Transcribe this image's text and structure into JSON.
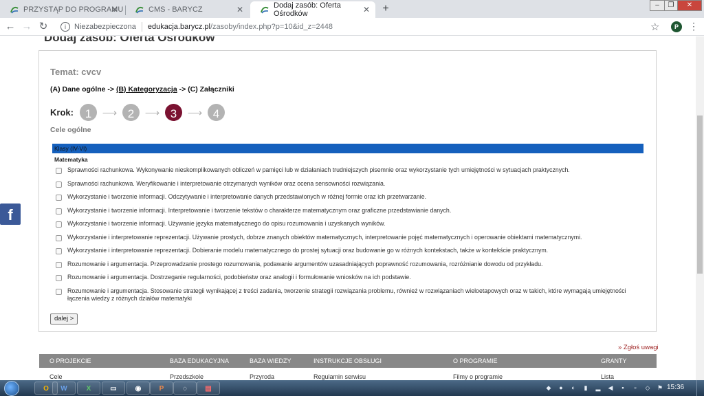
{
  "browser": {
    "tabs": [
      {
        "label": "PRZYSTĄP DO PROGRAMU",
        "active": false
      },
      {
        "label": "CMS - BARYCZ",
        "active": false
      },
      {
        "label": "Dodaj zasób: Oferta Ośrodków",
        "active": true
      }
    ],
    "new_tab_symbol": "+",
    "security_label": "Niezabezpieczona",
    "url_host": "edukacja.barycz.pl",
    "url_path": "/zasoby/index.php?p=10&id_z=2448",
    "profile_initial": "P"
  },
  "page": {
    "heading": "Dodaj zasób: Oferta Ośrodków",
    "topic": "Temat: cvcv",
    "path": {
      "part_a": "(A) Dane ogólne ->",
      "part_b": "(B) Kategoryzacja",
      "part_c": "-> (C) Załączniki"
    },
    "krok_label": "Krok:",
    "steps": [
      "1",
      "2",
      "3",
      "4"
    ],
    "current_step": 3,
    "goals_title": "Cele ogólne",
    "class_bar": "Klasy (IV-VI)",
    "subject": "Matematyka",
    "goals": [
      "Sprawności rachunkowa. Wykonywanie nieskomplikowanych obliczeń w pamięci lub w działaniach trudniejszych pisemnie oraz wykorzystanie tych umiejętności w sytuacjach praktycznych.",
      "Sprawności rachunkowa. Weryfikowanie i interpretowanie otrzymanych wyników oraz ocena sensowności rozwiązania.",
      "Wykorzystanie i tworzenie informacji. Odczytywanie i interpretowanie danych przedstawionych w różnej formie oraz ich przetwarzanie.",
      "Wykorzystanie i tworzenie informacji. Interpretowanie i tworzenie tekstów o charakterze matematycznym oraz graficzne przedstawianie danych.",
      "Wykorzystanie i tworzenie informacji. Używanie języka matematycznego do opisu rozumowania i uzyskanych wyników.",
      "Wykorzystanie i interpretowanie reprezentacji. Używanie prostych, dobrze znanych obiektów matematycznych, interpretowanie pojęć matematycznych i operowanie obiektami matematycznymi.",
      "Wykorzystanie i interpretowanie reprezentacji. Dobieranie modelu matematycznego do prostej sytuacji oraz budowanie go w różnych kontekstach, także w kontekście praktycznym.",
      "Rozumowanie i argumentacja. Przeprowadzanie prostego rozumowania, podawanie argumentów uzasadniających poprawność rozumowania, rozróżnianie dowodu od przykładu.",
      "Rozumowanie i argumentacja. Dostrzeganie regularności, podobieństw oraz analogii i formułowanie wniosków na ich podstawie.",
      "Rozumowanie i argumentacja. Stosowanie strategii wynikającej z treści zadania, tworzenie strategii rozwiązania problemu, również w rozwiązaniach wieloetapowych oraz w takich, które wymagają umiejętności łączenia wiedzy z różnych działów matematyki"
    ],
    "next_button": "dalej >",
    "report_link": "» Zgłoś uwagi",
    "facebook_letter": "f"
  },
  "footer": {
    "headers": [
      "O PROJEKCIE",
      "BAZA EDUKACYJNA",
      "BAZA WIEDZY",
      "INSTRUKCJE OBSŁUGI",
      "O PROGRAMIE",
      "GRANTY"
    ],
    "links": [
      "Cele",
      "Przedszkole",
      "Przyroda",
      "Regulamin serwisu",
      "Filmy o programie",
      "Lista"
    ]
  },
  "taskbar": {
    "apps": [
      "O",
      "W",
      "X",
      "",
      "",
      "P",
      "",
      ""
    ],
    "clock": "15:36"
  },
  "colors": {
    "current_step": "#7b1231",
    "class_bar": "#1560bd",
    "report_link": "#9b1b1b",
    "facebook": "#3b5998"
  }
}
